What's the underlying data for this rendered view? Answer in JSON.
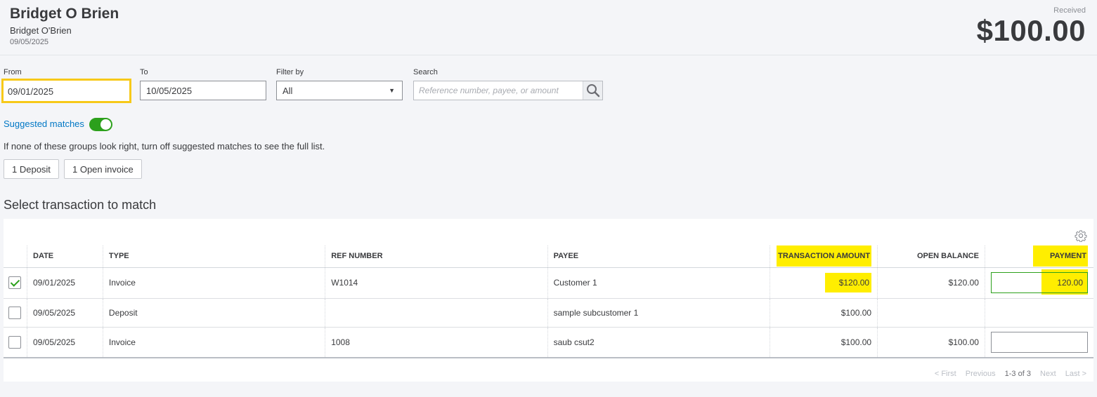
{
  "header": {
    "title": "Bridget O Brien",
    "subtitle": "Bridget O'Brien",
    "date": "09/05/2025",
    "received_label": "Received",
    "received_amount": "$100.00"
  },
  "filters": {
    "from_label": "From",
    "from_value": "09/01/2025",
    "to_label": "To",
    "to_value": "10/05/2025",
    "filter_label": "Filter by",
    "filter_value": "All",
    "search_label": "Search",
    "search_placeholder": "Reference number, payee, or amount"
  },
  "suggested": {
    "label": "Suggested matches",
    "enabled": true,
    "hint": "If none of these groups look right, turn off suggested matches to see the full list.",
    "groups": [
      "1 Deposit",
      "1 Open invoice"
    ]
  },
  "section_title": "Select transaction to match",
  "table": {
    "columns": [
      "DATE",
      "TYPE",
      "REF NUMBER",
      "PAYEE",
      "TRANSACTION AMOUNT",
      "OPEN BALANCE",
      "PAYMENT"
    ],
    "rows": [
      {
        "checked": true,
        "date": "09/01/2025",
        "type": "Invoice",
        "ref": "W1014",
        "payee": "Customer 1",
        "amount": "$120.00",
        "open_balance": "$120.00",
        "payment": "120.00",
        "has_payment_field": true
      },
      {
        "checked": false,
        "date": "09/05/2025",
        "type": "Deposit",
        "ref": "",
        "payee": "sample subcustomer 1",
        "amount": "$100.00",
        "open_balance": "",
        "payment": "",
        "has_payment_field": false
      },
      {
        "checked": false,
        "date": "09/05/2025",
        "type": "Invoice",
        "ref": "1008",
        "payee": "saub csut2",
        "amount": "$100.00",
        "open_balance": "$100.00",
        "payment": "",
        "has_payment_field": true
      }
    ]
  },
  "pager": {
    "first": "< First",
    "previous": "Previous",
    "range": "1-3 of 3",
    "next": "Next",
    "last": "Last >"
  },
  "colors": {
    "accent_green": "#2ca01c",
    "link_blue": "#0077c5",
    "highlight_yellow": "#ffee00",
    "focus_outline": "#f7c919"
  },
  "icons": [
    "search-icon",
    "gear-icon",
    "check-icon",
    "caret-down-icon"
  ]
}
